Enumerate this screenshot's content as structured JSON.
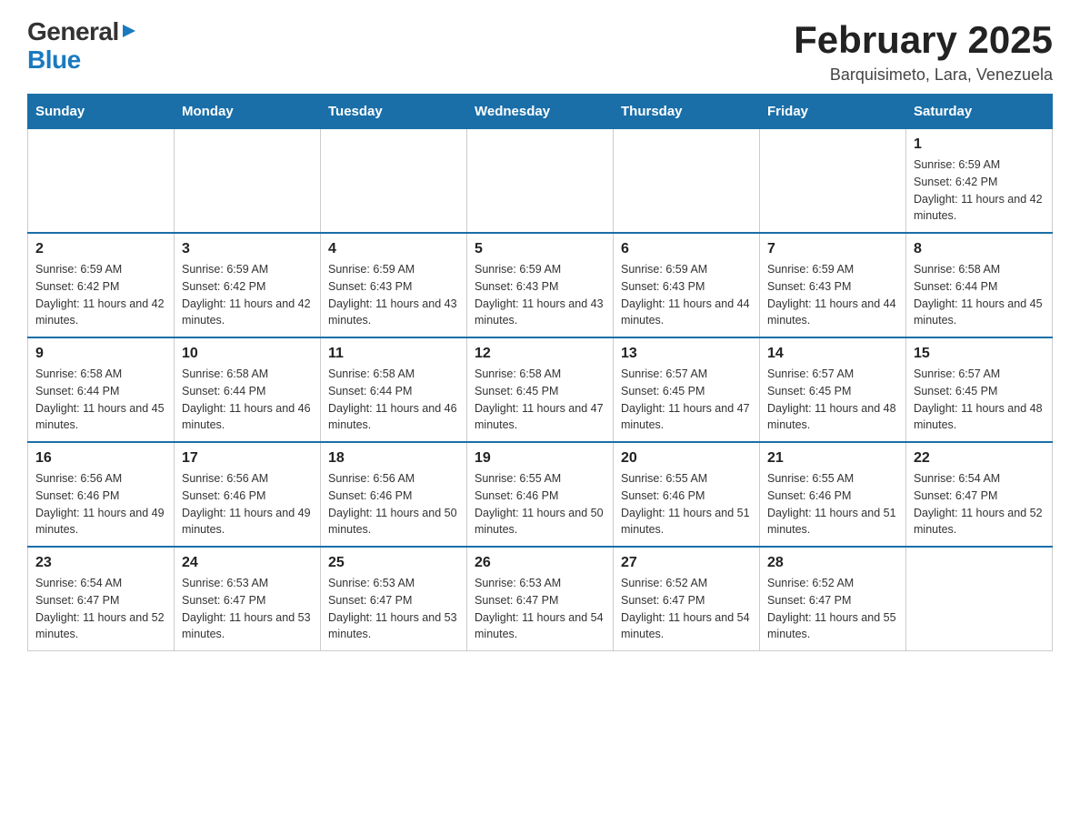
{
  "header": {
    "logo": {
      "general": "General",
      "blue": "Blue",
      "arrow": "▶"
    },
    "title": "February 2025",
    "location": "Barquisimeto, Lara, Venezuela"
  },
  "days_of_week": [
    "Sunday",
    "Monday",
    "Tuesday",
    "Wednesday",
    "Thursday",
    "Friday",
    "Saturday"
  ],
  "weeks": [
    [
      {
        "day": "",
        "info": ""
      },
      {
        "day": "",
        "info": ""
      },
      {
        "day": "",
        "info": ""
      },
      {
        "day": "",
        "info": ""
      },
      {
        "day": "",
        "info": ""
      },
      {
        "day": "",
        "info": ""
      },
      {
        "day": "1",
        "info": "Sunrise: 6:59 AM\nSunset: 6:42 PM\nDaylight: 11 hours and 42 minutes."
      }
    ],
    [
      {
        "day": "2",
        "info": "Sunrise: 6:59 AM\nSunset: 6:42 PM\nDaylight: 11 hours and 42 minutes."
      },
      {
        "day": "3",
        "info": "Sunrise: 6:59 AM\nSunset: 6:42 PM\nDaylight: 11 hours and 42 minutes."
      },
      {
        "day": "4",
        "info": "Sunrise: 6:59 AM\nSunset: 6:43 PM\nDaylight: 11 hours and 43 minutes."
      },
      {
        "day": "5",
        "info": "Sunrise: 6:59 AM\nSunset: 6:43 PM\nDaylight: 11 hours and 43 minutes."
      },
      {
        "day": "6",
        "info": "Sunrise: 6:59 AM\nSunset: 6:43 PM\nDaylight: 11 hours and 44 minutes."
      },
      {
        "day": "7",
        "info": "Sunrise: 6:59 AM\nSunset: 6:43 PM\nDaylight: 11 hours and 44 minutes."
      },
      {
        "day": "8",
        "info": "Sunrise: 6:58 AM\nSunset: 6:44 PM\nDaylight: 11 hours and 45 minutes."
      }
    ],
    [
      {
        "day": "9",
        "info": "Sunrise: 6:58 AM\nSunset: 6:44 PM\nDaylight: 11 hours and 45 minutes."
      },
      {
        "day": "10",
        "info": "Sunrise: 6:58 AM\nSunset: 6:44 PM\nDaylight: 11 hours and 46 minutes."
      },
      {
        "day": "11",
        "info": "Sunrise: 6:58 AM\nSunset: 6:44 PM\nDaylight: 11 hours and 46 minutes."
      },
      {
        "day": "12",
        "info": "Sunrise: 6:58 AM\nSunset: 6:45 PM\nDaylight: 11 hours and 47 minutes."
      },
      {
        "day": "13",
        "info": "Sunrise: 6:57 AM\nSunset: 6:45 PM\nDaylight: 11 hours and 47 minutes."
      },
      {
        "day": "14",
        "info": "Sunrise: 6:57 AM\nSunset: 6:45 PM\nDaylight: 11 hours and 48 minutes."
      },
      {
        "day": "15",
        "info": "Sunrise: 6:57 AM\nSunset: 6:45 PM\nDaylight: 11 hours and 48 minutes."
      }
    ],
    [
      {
        "day": "16",
        "info": "Sunrise: 6:56 AM\nSunset: 6:46 PM\nDaylight: 11 hours and 49 minutes."
      },
      {
        "day": "17",
        "info": "Sunrise: 6:56 AM\nSunset: 6:46 PM\nDaylight: 11 hours and 49 minutes."
      },
      {
        "day": "18",
        "info": "Sunrise: 6:56 AM\nSunset: 6:46 PM\nDaylight: 11 hours and 50 minutes."
      },
      {
        "day": "19",
        "info": "Sunrise: 6:55 AM\nSunset: 6:46 PM\nDaylight: 11 hours and 50 minutes."
      },
      {
        "day": "20",
        "info": "Sunrise: 6:55 AM\nSunset: 6:46 PM\nDaylight: 11 hours and 51 minutes."
      },
      {
        "day": "21",
        "info": "Sunrise: 6:55 AM\nSunset: 6:46 PM\nDaylight: 11 hours and 51 minutes."
      },
      {
        "day": "22",
        "info": "Sunrise: 6:54 AM\nSunset: 6:47 PM\nDaylight: 11 hours and 52 minutes."
      }
    ],
    [
      {
        "day": "23",
        "info": "Sunrise: 6:54 AM\nSunset: 6:47 PM\nDaylight: 11 hours and 52 minutes."
      },
      {
        "day": "24",
        "info": "Sunrise: 6:53 AM\nSunset: 6:47 PM\nDaylight: 11 hours and 53 minutes."
      },
      {
        "day": "25",
        "info": "Sunrise: 6:53 AM\nSunset: 6:47 PM\nDaylight: 11 hours and 53 minutes."
      },
      {
        "day": "26",
        "info": "Sunrise: 6:53 AM\nSunset: 6:47 PM\nDaylight: 11 hours and 54 minutes."
      },
      {
        "day": "27",
        "info": "Sunrise: 6:52 AM\nSunset: 6:47 PM\nDaylight: 11 hours and 54 minutes."
      },
      {
        "day": "28",
        "info": "Sunrise: 6:52 AM\nSunset: 6:47 PM\nDaylight: 11 hours and 55 minutes."
      },
      {
        "day": "",
        "info": ""
      }
    ]
  ]
}
